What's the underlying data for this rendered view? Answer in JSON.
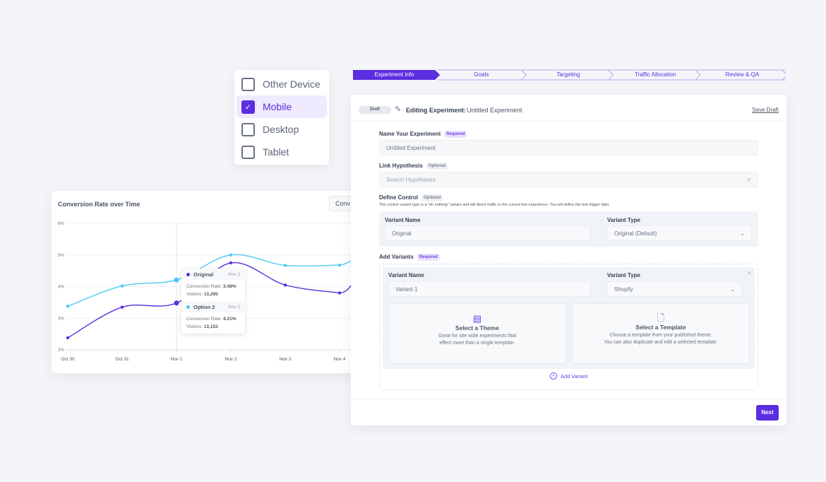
{
  "chart": {
    "title": "Conversion Rate over Time",
    "button_label": "Conv",
    "tooltip": {
      "date": "Nov 1",
      "items": [
        {
          "name": "Original",
          "rate_label": "Conversion Rate:",
          "rate": "3.48%",
          "visitors_label": "Visitors:",
          "visitors": "13,295"
        },
        {
          "name": "Option 2",
          "rate_label": "Conversion Rate:",
          "rate": "4.21%",
          "visitors_label": "Visitors:",
          "visitors": "13,153"
        }
      ]
    }
  },
  "chart_data": {
    "type": "line",
    "title": "Conversion Rate over Time",
    "categories": [
      "Oct 30",
      "Oct 31",
      "Nov 1",
      "Nov 2",
      "Nov 3",
      "Nov 4"
    ],
    "y_ticks": [
      "2%",
      "3%",
      "4%",
      "5%",
      "6%"
    ],
    "ylim": [
      2,
      6
    ],
    "grid": true,
    "series": [
      {
        "name": "Original",
        "color": "#5b2ee0",
        "values": [
          2.38,
          3.35,
          3.48,
          4.75,
          4.05,
          3.8
        ]
      },
      {
        "name": "Option 2",
        "color": "#4cc9f5",
        "values": [
          3.38,
          4.02,
          4.21,
          5.0,
          4.67,
          4.68
        ]
      }
    ],
    "highlighted": "Nov 1"
  },
  "devices": [
    {
      "label": "Other Device",
      "checked": false
    },
    {
      "label": "Mobile",
      "checked": true
    },
    {
      "label": "Desktop",
      "checked": false
    },
    {
      "label": "Tablet",
      "checked": false
    }
  ],
  "stepper": {
    "active": 0,
    "steps": [
      "Experiment Info",
      "Goals",
      "Targeting",
      "Traffic Allocation",
      "Review & QA"
    ]
  },
  "form": {
    "status": "Draft",
    "editing_label": "Editing Experiment:",
    "experiment_name": "Untitled Experiment",
    "save_draft": "Save Draft",
    "name_label": "Name Your Experiment",
    "required": "Required",
    "optional": "Optional",
    "name_value": "Untitled Experiment",
    "hypothesis_label": "Link Hypothesis",
    "hypothesis_placeholder": "Search Hypotheses",
    "control_label": "Define Control",
    "control_desc": "The control variant type is a \"do nothing\" variant and will direct traffic to the current live experience. You will define the test trigger later.",
    "variant_name_label": "Variant Name",
    "variant_type_label": "Variant Type",
    "control_name": "Original",
    "control_type": "Original (Default)",
    "add_variants_label": "Add Variants",
    "variant1_name": "Variant 1",
    "variant1_type": "Shopify",
    "theme_title": "Select a Theme",
    "theme_desc1": "Great for site wide experiments that",
    "theme_desc2": "effect more than a single template.",
    "template_title": "Select a Template",
    "template_desc1": "Choose a template from your published theme.",
    "template_desc2": "You can also duplicate and edit a selected template.",
    "add_variant": "Add Variant",
    "next": "Next"
  },
  "colors": {
    "accent": "#5b2ee0",
    "series2": "#4cc9f5"
  }
}
